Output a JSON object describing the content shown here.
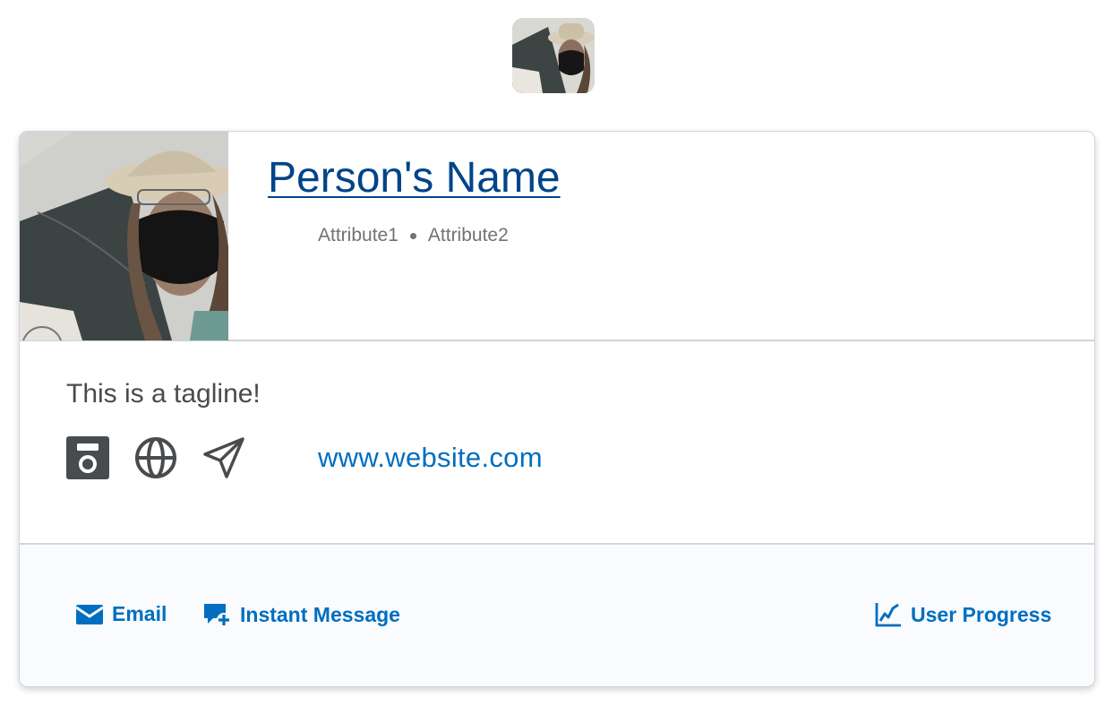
{
  "profile": {
    "name": "Person's Name",
    "attributes": [
      "Attribute1",
      "Attribute2"
    ],
    "tagline": "This is a tagline!",
    "website": "www.website.com"
  },
  "social_icons": [
    "save-icon",
    "globe-icon",
    "send-icon"
  ],
  "actions": {
    "email": "Email",
    "instant_message": "Instant Message",
    "user_progress": "User Progress"
  },
  "colors": {
    "link": "#004489",
    "action": "#006fbf",
    "text": "#494c4e",
    "muted": "#6e7376",
    "border": "#cdd5dc",
    "footer_bg": "#f9fbff"
  }
}
